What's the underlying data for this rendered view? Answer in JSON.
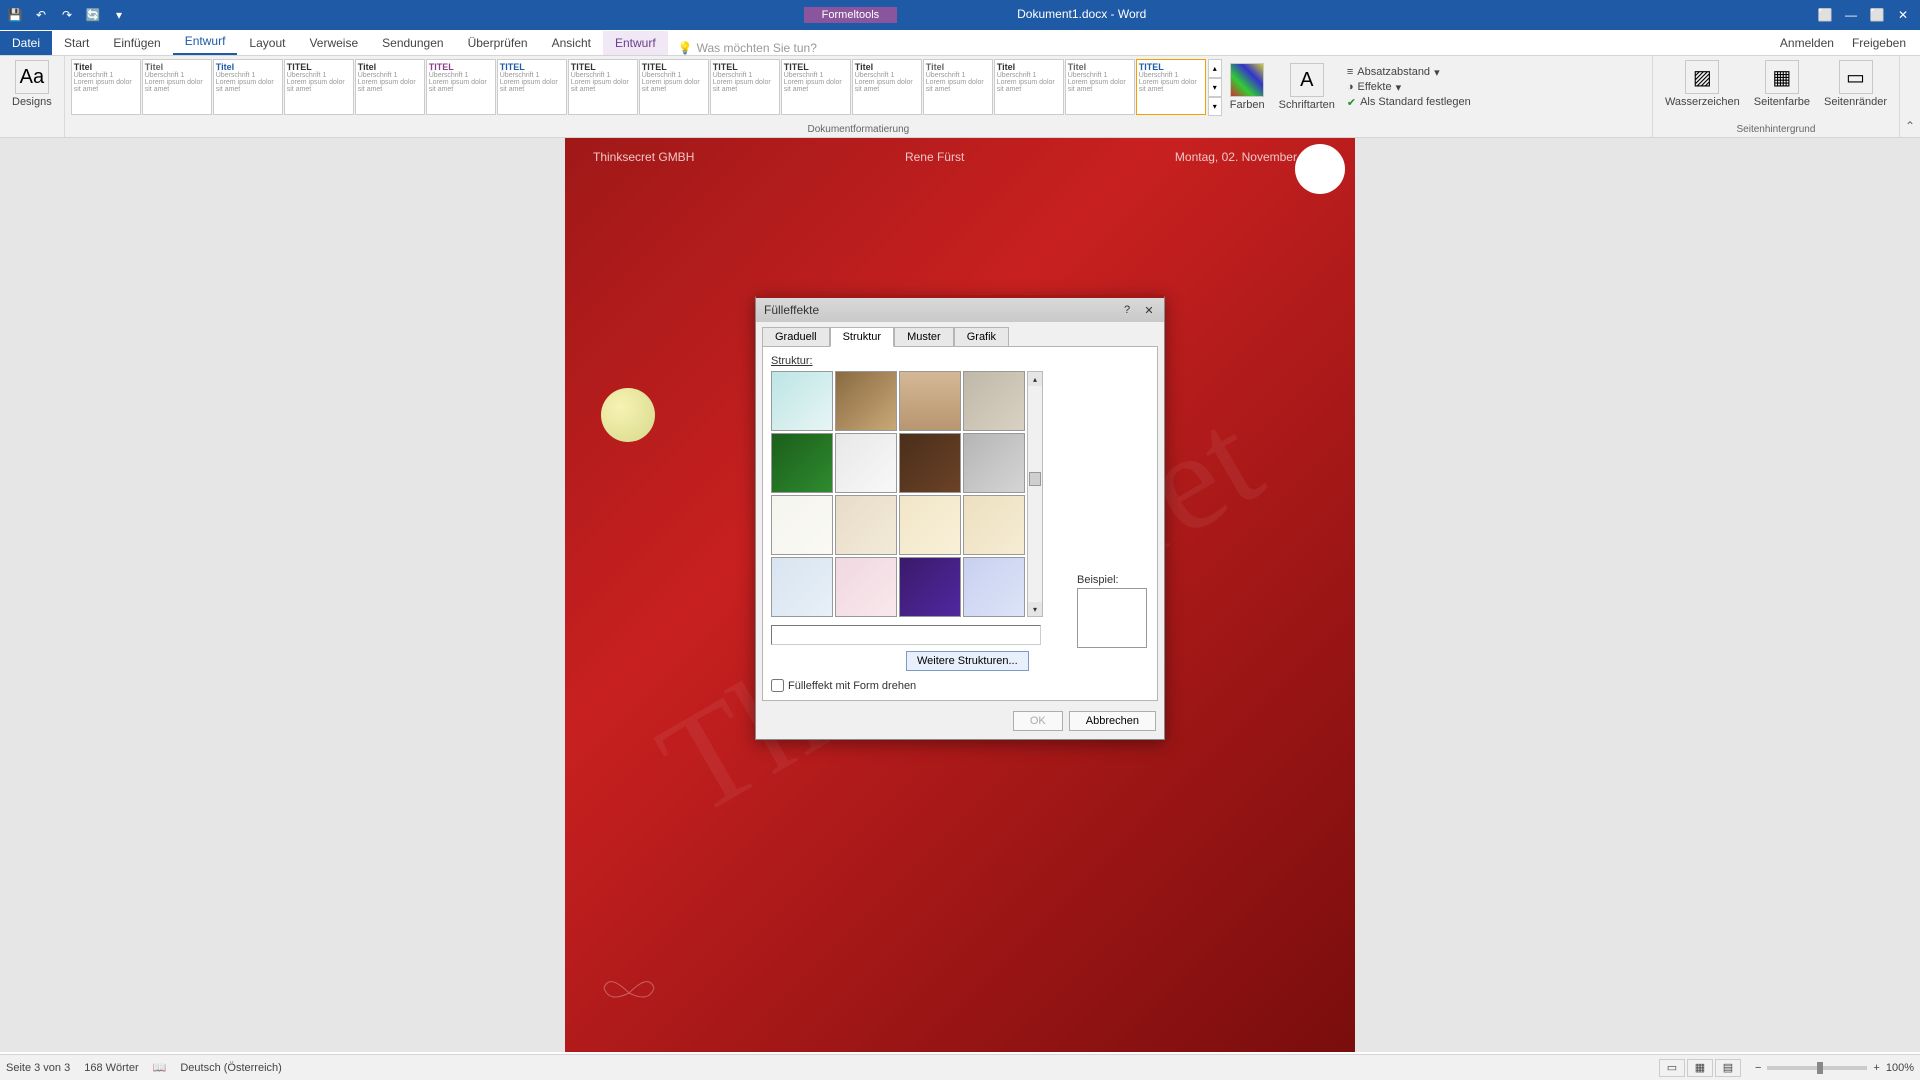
{
  "app": {
    "doc_title": "Dokument1.docx - Word",
    "contextual_label": "Formeltools"
  },
  "qat": [
    "💾",
    "↶",
    "↷",
    "🔄"
  ],
  "win_controls": [
    "⬜",
    "—",
    "⬜",
    "✕"
  ],
  "tabs": [
    "Datei",
    "Start",
    "Einfügen",
    "Entwurf",
    "Layout",
    "Verweise",
    "Sendungen",
    "Überprüfen",
    "Ansicht",
    "Entwurf"
  ],
  "active_tab_index": 3,
  "tell_me_placeholder": "Was möchten Sie tun?",
  "ribbon_right": {
    "signin": "Anmelden",
    "share": "Freigeben"
  },
  "ribbon": {
    "designs_label": "Designs",
    "doc_format_group": "Dokumentformatierung",
    "colors": "Farben",
    "fonts": "Schriftarten",
    "para_spacing": "Absatzabstand",
    "effects": "Effekte",
    "set_default": "Als Standard festlegen",
    "page_bg_group": "Seitenhintergrund",
    "watermark": "Wasserzeichen",
    "page_color": "Seitenfarbe",
    "page_borders": "Seitenränder",
    "themes": [
      {
        "t": "Titel",
        "c": "#333"
      },
      {
        "t": "Titel",
        "c": "#666"
      },
      {
        "t": "Titel",
        "c": "#1e5aa6"
      },
      {
        "t": "TITEL",
        "c": "#333"
      },
      {
        "t": "Titel",
        "c": "#333"
      },
      {
        "t": "TITEL",
        "c": "#8a3d8a"
      },
      {
        "t": "TITEL",
        "c": "#1e5aa6"
      },
      {
        "t": "TITEL",
        "c": "#333"
      },
      {
        "t": "TITEL",
        "c": "#333"
      },
      {
        "t": "TITEL",
        "c": "#333"
      },
      {
        "t": "TITEL",
        "c": "#333"
      },
      {
        "t": "Titel",
        "c": "#333"
      },
      {
        "t": "Titel",
        "c": "#666"
      },
      {
        "t": "Titel",
        "c": "#333"
      },
      {
        "t": "Titel",
        "c": "#666"
      },
      {
        "t": "TITEL",
        "c": "#1e5aa6"
      }
    ]
  },
  "page": {
    "company": "Thinksecret GMBH",
    "author": "Rene Fürst",
    "date": "Montag, 02. November 2015",
    "watermark_text": "Thinksecret"
  },
  "dialog": {
    "title": "Fülleffekte",
    "tabs": [
      "Graduell",
      "Struktur",
      "Muster",
      "Grafik"
    ],
    "active_tab": 1,
    "struktur_label": "Struktur:",
    "more_textures": "Weitere Strukturen...",
    "rotate_label": "Fülleffekt mit Form drehen",
    "preview_label": "Beispiel:",
    "ok": "OK",
    "cancel": "Abbrechen",
    "textures": [
      "linear-gradient(135deg,#bde5e5,#e8f5f5)",
      "linear-gradient(135deg,#8a6a42,#c9a877)",
      "linear-gradient(180deg,#d4b896,#b89670)",
      "linear-gradient(135deg,#bfb8a8,#d9d2c4)",
      "linear-gradient(135deg,#1b5e1b,#2e8b2e)",
      "linear-gradient(135deg,#e8e8e8,#f8f8f8)",
      "linear-gradient(135deg,#4a2e1a,#6b4226)",
      "linear-gradient(135deg,#b5b5b5,#d5d5d5)",
      "linear-gradient(135deg,#f5f5f0,#faf9f4)",
      "linear-gradient(135deg,#e8dcc8,#f2ead8)",
      "linear-gradient(135deg,#f2e6c8,#f8f0d8)",
      "linear-gradient(135deg,#ede0c0,#f5ecd4)",
      "linear-gradient(135deg,#d8e4f0,#e8f0f8)",
      "linear-gradient(135deg,#f0d8e0,#f8e8ec)",
      "linear-gradient(135deg,#3a1a6a,#5028a0)",
      "linear-gradient(135deg,#c8d0f0,#dce4f8)"
    ]
  },
  "status": {
    "page": "Seite 3 von 3",
    "words": "168 Wörter",
    "lang": "Deutsch (Österreich)",
    "zoom": "100%"
  }
}
